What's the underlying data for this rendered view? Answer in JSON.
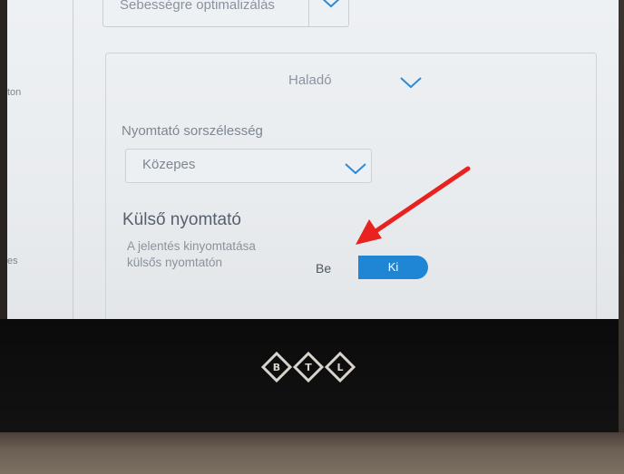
{
  "screen": {
    "left_nav_fragments": [
      "ton",
      "es"
    ],
    "top_select": {
      "value": "Sebességre optimalizálás"
    },
    "advanced_select": {
      "value": "Haladó"
    },
    "print_width": {
      "label": "Nyomtató sorszélesség",
      "value": "Közepes"
    },
    "external_printer": {
      "title": "Külső nyomtató",
      "description": "A jelentés kinyomtatása külsős nyomtatón",
      "toggle": {
        "on_label": "Be",
        "off_label": "Ki",
        "selected": "Ki"
      }
    }
  },
  "device": {
    "logo_letters": [
      "B",
      "T",
      "L"
    ]
  },
  "colors": {
    "toggle_active": "#1f86d6",
    "annotation_arrow": "#e8231f"
  }
}
